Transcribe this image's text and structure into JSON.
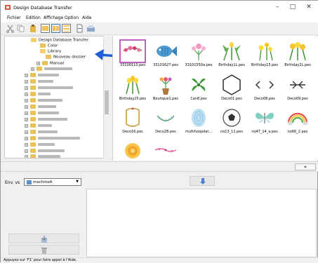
{
  "window": {
    "title": "Design Database Transfer",
    "minimize": "–",
    "maximize": "□",
    "close": "✕"
  },
  "menu": [
    "Fichier",
    "Edition",
    "Affichage",
    "Option",
    "Aide"
  ],
  "tree": {
    "root": "Design Database Transfer",
    "children": [
      "Color",
      "Library",
      "Nouveau dossier",
      "Manual"
    ]
  },
  "gallery": {
    "files": [
      {
        "name": "33100110.pes",
        "icon": "floral-garland-embroidery"
      },
      {
        "name": "33101627.pes",
        "icon": "fish-embroidery"
      },
      {
        "name": "33101550a.pes",
        "icon": "flower-bouquet-embroidery"
      },
      {
        "name": "Birthday1L.pes",
        "icon": "tulips-embroidery"
      },
      {
        "name": "Birthday15.pes",
        "icon": "daffodils-embroidery"
      },
      {
        "name": "Birthday2L.pes",
        "icon": "daffodils-embroidery"
      },
      {
        "name": "Birthday25.pes",
        "icon": "tulips-embroidery"
      },
      {
        "name": "Boutique1.pes",
        "icon": "flowers-pot-embroidery"
      },
      {
        "name": "Can8.pes",
        "icon": "leaves-embroidery"
      },
      {
        "name": "Deco01.pes",
        "icon": "hexagon-frame-embroidery"
      },
      {
        "name": "Deco08.pes",
        "icon": "chevrons-embroidery"
      },
      {
        "name": "Deco09.pes",
        "icon": "ornament-embroidery"
      },
      {
        "name": "Deco16.pes",
        "icon": "gold-frame-embroidery"
      },
      {
        "name": "Deco28.pes",
        "icon": "wreath-embroidery"
      },
      {
        "name": "multihoopdat...",
        "icon": "fingerprint-embroidery"
      },
      {
        "name": "no13_11.pes",
        "icon": "soccer-ball-embroidery"
      },
      {
        "name": "no47_14_a.pes",
        "icon": "butterfly-embroidery"
      },
      {
        "name": "no66_2.pes",
        "icon": "rainbow-embroidery"
      },
      {
        "name": "",
        "icon": "sunflower-embroidery"
      },
      {
        "name": "",
        "icon": "pink-border-embroidery"
      }
    ]
  },
  "bottom": {
    "send_label": "Env. vs",
    "machine_value": "machineA",
    "collapse_icon": "»"
  },
  "status": "Appuyez sur 'F1' pour faire appel à l'Aide."
}
